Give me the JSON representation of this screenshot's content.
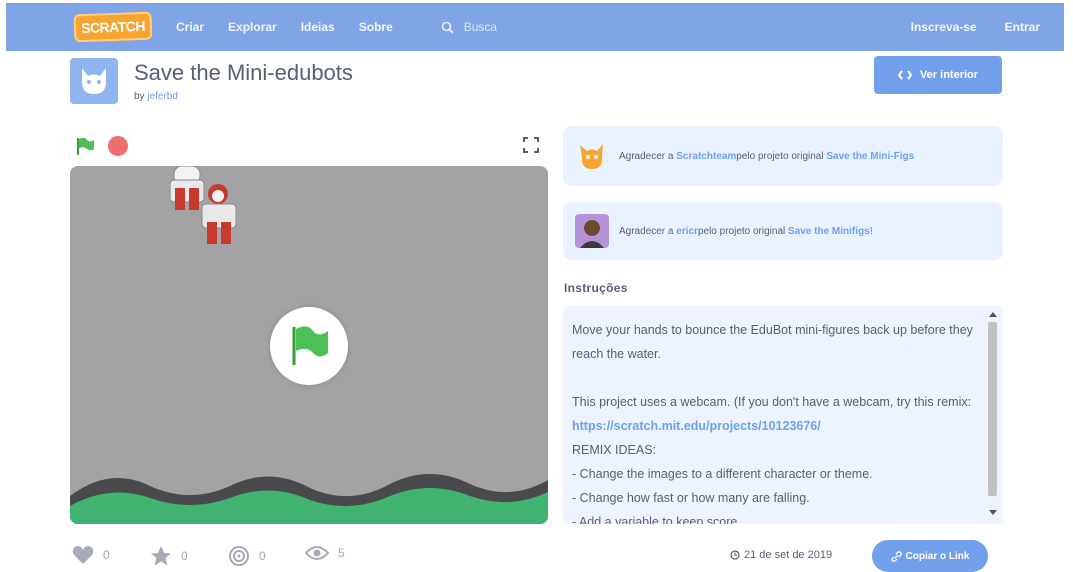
{
  "nav": {
    "logo_text": "SCRATCH",
    "links": [
      "Criar",
      "Explorar",
      "Ideias",
      "Sobre"
    ],
    "search_placeholder": "Busca",
    "join": "Inscreva-se",
    "signin": "Entrar"
  },
  "project": {
    "title": "Save the Mini-edubots",
    "by_prefix": "by",
    "author": "jeferbd",
    "see_inside": "Ver interior"
  },
  "credits": [
    {
      "prefix": "Agradecer a ",
      "user": "Scratchteam",
      "middle": "pelo projeto original ",
      "project": "Save the Mini-Figs"
    },
    {
      "prefix": "Agradecer a ",
      "user": "ericr",
      "middle": "pelo projeto original ",
      "project": "Save the Minifigs!"
    }
  ],
  "instructions": {
    "heading": "Instruções",
    "line1": "Move your hands to bounce the EduBot mini-figures back up before they reach the water.",
    "line2": "This project uses a webcam. (If you don't have a webcam, try this remix: ",
    "url": "https://scratch.mit.edu/projects/10123676/",
    "line3": "REMIX IDEAS:",
    "bullets": [
      "- Change the images to a different character or theme.",
      "- Change how fast or how many are falling.",
      "- Add a variable to keep score."
    ]
  },
  "stats": {
    "loves": "0",
    "favorites": "0",
    "remixes": "0",
    "views": "5"
  },
  "shared_date": "21 de set de 2019",
  "copy_link": "Copiar o Link",
  "colors": {
    "nav": "#7fa5e6",
    "accent": "#73a0ec",
    "stage_bg": "#a3a3a5",
    "hill_dark": "#4a4a4c",
    "hill_green": "#3fb36f"
  }
}
